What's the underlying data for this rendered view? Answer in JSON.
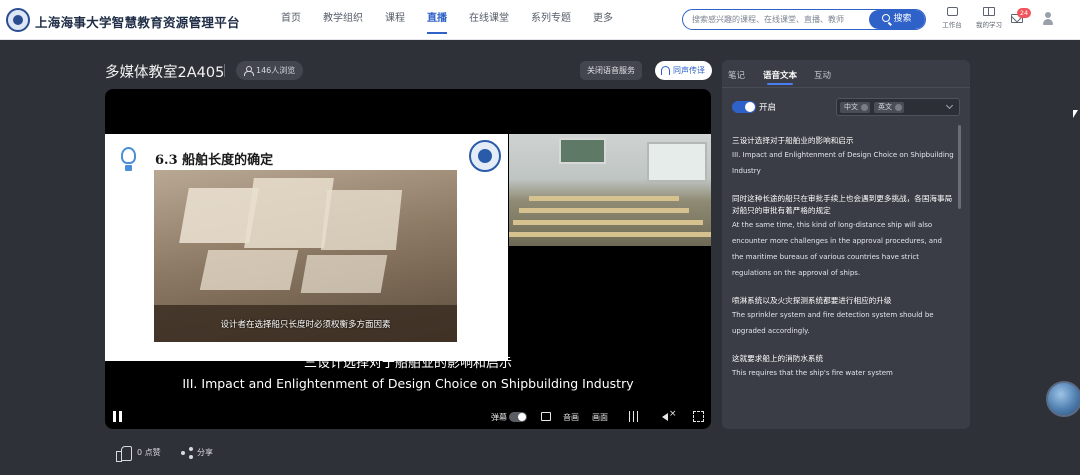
{
  "header": {
    "brand": "上海海事大学智慧教育资源管理平台",
    "nav": [
      "首页",
      "教学组织",
      "课程",
      "直播",
      "在线课堂",
      "系列专题",
      "更多"
    ],
    "active_nav": "直播",
    "search_placeholder": "搜索感兴趣的课程、在线课堂、直播、教师",
    "search_button": "搜索",
    "workbench": "工作台",
    "my_study": "我的学习",
    "message_count": "24"
  },
  "room": {
    "title": "多媒体教室2A405",
    "views": "146人浏览",
    "close_voice_service": "关闭语音服务",
    "interpretation": "同声传译"
  },
  "video": {
    "slide_title": "6.3 船舶长度的确定",
    "slide_caption": "设计者在选择船只长度时必须权衡多方面因素",
    "subtitle_cn": "三设计选择对于船舶业的影响和启示",
    "subtitle_en": "III. Impact and Enlightenment of Design Choice on Shipbuilding Industry",
    "controls": {
      "danmu": "弹幕",
      "audio": "音画",
      "picture": "画面"
    }
  },
  "actions": {
    "like": "0 点赞",
    "share": "分享"
  },
  "panel": {
    "tabs": [
      "笔记",
      "语音文本",
      "互动"
    ],
    "active_tab": "语音文本",
    "switch_label": "开启",
    "languages": [
      "中文",
      "英文"
    ],
    "transcript": [
      {
        "cn": "三设计选择对于船舶业的影响和启示",
        "en": "III. Impact and Enlightenment of Design Choice on Shipbuilding Industry"
      },
      {
        "cn": "同时这种长途的船只在审批手续上也会遇到更多挑战，各国海事局对船只的审批有着严格的规定",
        "en": "At the same time, this kind of long-distance ship will also encounter more challenges in the approval procedures, and the maritime bureaus of various countries have strict regulations on the approval of ships."
      },
      {
        "cn": "喷淋系统以及火灾探测系统都要进行相应的升级",
        "en": "The sprinkler system and fire detection system should be upgraded accordingly."
      },
      {
        "cn": "这就要求船上的消防水系统",
        "en": "This requires that the ship's fire water system"
      }
    ]
  }
}
